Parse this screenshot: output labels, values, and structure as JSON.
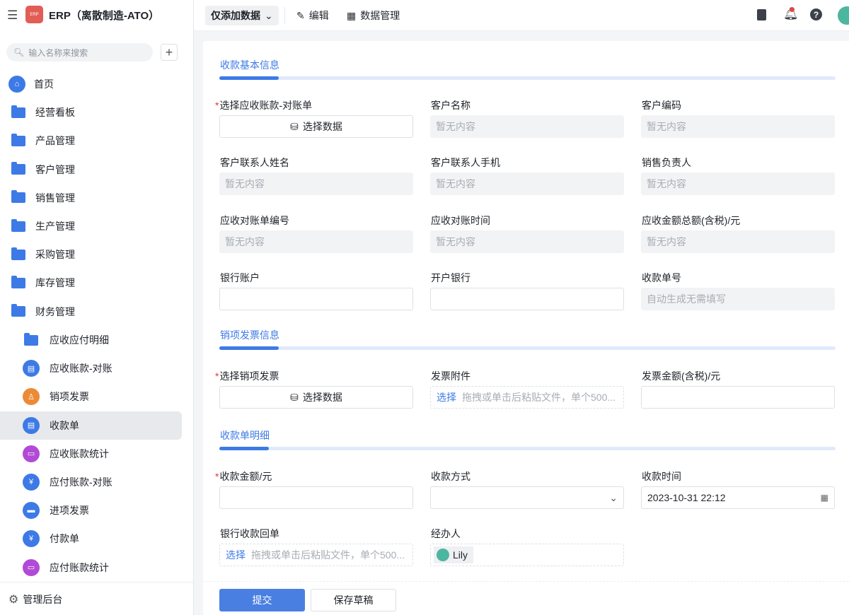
{
  "app": {
    "title": "ERP（离散制造-ATO）",
    "logo_text": "ERP"
  },
  "sidebar": {
    "search_placeholder": "输入名称来搜索",
    "items": [
      {
        "label": "首页",
        "icon": "home-icon"
      },
      {
        "label": "经营看板",
        "icon": "folder-icon"
      },
      {
        "label": "产品管理",
        "icon": "folder-icon"
      },
      {
        "label": "客户管理",
        "icon": "folder-icon"
      },
      {
        "label": "销售管理",
        "icon": "folder-icon"
      },
      {
        "label": "生产管理",
        "icon": "folder-icon"
      },
      {
        "label": "采购管理",
        "icon": "folder-icon"
      },
      {
        "label": "库存管理",
        "icon": "folder-icon"
      },
      {
        "label": "财务管理",
        "icon": "folder-open-icon"
      }
    ],
    "sub_items": [
      {
        "label": "应收应付明细",
        "icon": "folder-icon",
        "color": "#3d7ae6"
      },
      {
        "label": "应收账款-对账",
        "icon": "document-icon",
        "color": "#3d7ae6"
      },
      {
        "label": "销项发票",
        "icon": "org-chart-icon",
        "color": "#ec8a35"
      },
      {
        "label": "收款单",
        "icon": "document-icon",
        "color": "#3d7ae6",
        "active": true
      },
      {
        "label": "应收账款统计",
        "icon": "monitor-chart-icon",
        "color": "#b14ad6"
      },
      {
        "label": "应付账款-对账",
        "icon": "yuan-house-icon",
        "color": "#3d7ae6"
      },
      {
        "label": "进项发票",
        "icon": "wallet-icon",
        "color": "#3d7ae6"
      },
      {
        "label": "付款单",
        "icon": "yuan-house-icon",
        "color": "#3d7ae6"
      },
      {
        "label": "应付账款统计",
        "icon": "monitor-chart-icon",
        "color": "#b14ad6"
      }
    ],
    "footer": "管理后台"
  },
  "topbar": {
    "view_select": "仅添加数据",
    "edit": "编辑",
    "data_manage": "数据管理"
  },
  "sections": [
    {
      "title": "收款基本信息",
      "fields": [
        {
          "label": "选择应收账款-对账单",
          "required": true,
          "type": "select-data",
          "value": "选择数据"
        },
        {
          "label": "客户名称",
          "type": "readonly",
          "value": "暂无内容"
        },
        {
          "label": "客户编码",
          "type": "readonly",
          "value": "暂无内容"
        },
        {
          "label": "客户联系人姓名",
          "type": "readonly",
          "value": "暂无内容"
        },
        {
          "label": "客户联系人手机",
          "type": "readonly",
          "value": "暂无内容"
        },
        {
          "label": "销售负责人",
          "type": "readonly",
          "value": "暂无内容"
        },
        {
          "label": "应收对账单编号",
          "type": "readonly",
          "value": "暂无内容"
        },
        {
          "label": "应收对账时间",
          "type": "readonly",
          "value": "暂无内容"
        },
        {
          "label": "应收金额总额(含税)/元",
          "type": "readonly",
          "value": "暂无内容"
        },
        {
          "label": "银行账户",
          "type": "input",
          "value": ""
        },
        {
          "label": "开户银行",
          "type": "input",
          "value": ""
        },
        {
          "label": "收款单号",
          "type": "readonly",
          "value": "自动生成无需填写"
        }
      ]
    },
    {
      "title": "销项发票信息",
      "fields": [
        {
          "label": "选择销项发票",
          "required": true,
          "type": "select-data",
          "value": "选择数据"
        },
        {
          "label": "发票附件",
          "type": "upload",
          "link": "选择",
          "value": "拖拽或单击后粘贴文件，单个500..."
        },
        {
          "label": "发票金额(含税)/元",
          "type": "input",
          "value": ""
        }
      ]
    },
    {
      "title": "收款单明细",
      "fields": [
        {
          "label": "收款金额/元",
          "required": true,
          "type": "input",
          "value": ""
        },
        {
          "label": "收款方式",
          "type": "dropdown",
          "value": ""
        },
        {
          "label": "收款时间",
          "type": "datetime",
          "value": "2023-10-31 22:12"
        },
        {
          "label": "银行收款回单",
          "type": "upload",
          "link": "选择",
          "value": "拖拽或单击后粘贴文件，单个500..."
        },
        {
          "label": "经办人",
          "type": "user",
          "value": "Lily"
        }
      ]
    }
  ],
  "actions": {
    "submit": "提交",
    "save_draft": "保存草稿"
  },
  "colors": {
    "accent": "#3d7ae6",
    "required": "#e33333"
  }
}
